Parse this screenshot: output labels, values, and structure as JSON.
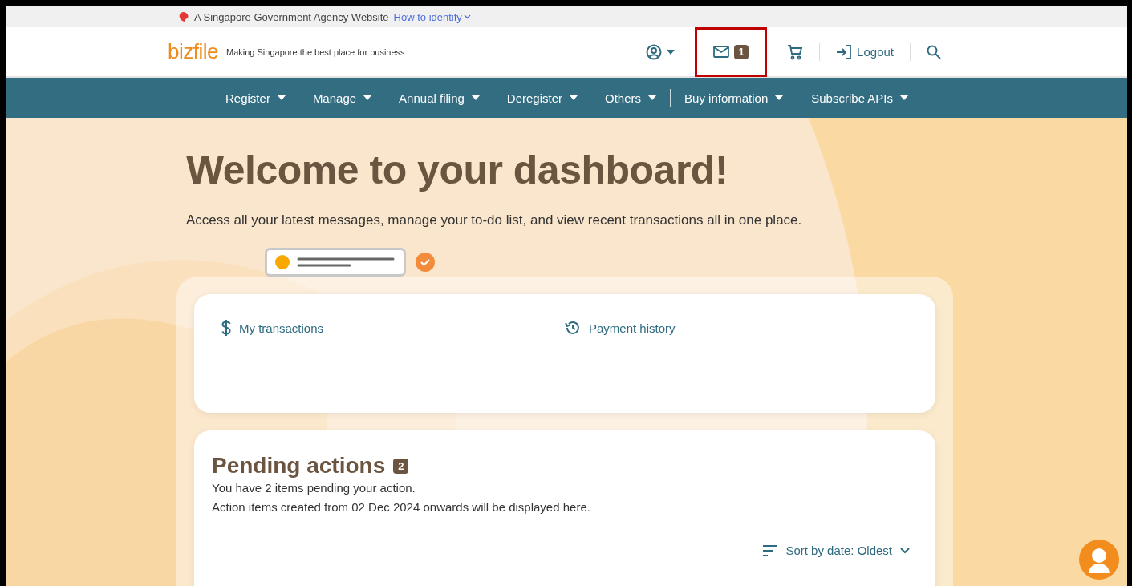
{
  "masthead": {
    "text": "A Singapore Government Agency Website",
    "link": "How to identify"
  },
  "header": {
    "logo": "bizfile",
    "tagline": "Making Singapore the best place for business",
    "mail_count": "1",
    "mail_highlighted": true,
    "logout": "Logout"
  },
  "nav": {
    "items": [
      {
        "label": "Register",
        "divider_before": false
      },
      {
        "label": "Manage",
        "divider_before": false
      },
      {
        "label": "Annual filing",
        "divider_before": false
      },
      {
        "label": "Deregister",
        "divider_before": false
      },
      {
        "label": "Others",
        "divider_before": false
      },
      {
        "label": "Buy information",
        "divider_before": true
      },
      {
        "label": "Subscribe APIs",
        "divider_before": true
      }
    ]
  },
  "hero": {
    "title": "Welcome to your dashboard!",
    "subtitle": "Access all your latest messages, manage your to-do list, and view recent transactions all in one place."
  },
  "quick_links": [
    {
      "label": "My transactions",
      "kind": "dollar"
    },
    {
      "label": "Payment history",
      "kind": "history"
    }
  ],
  "pending": {
    "title": "Pending actions",
    "count": "2",
    "lines": [
      "You have 2 items pending your action.",
      "Action items created from 02 Dec 2024 onwards will be displayed here."
    ],
    "sort": "Sort by date: Oldest"
  }
}
